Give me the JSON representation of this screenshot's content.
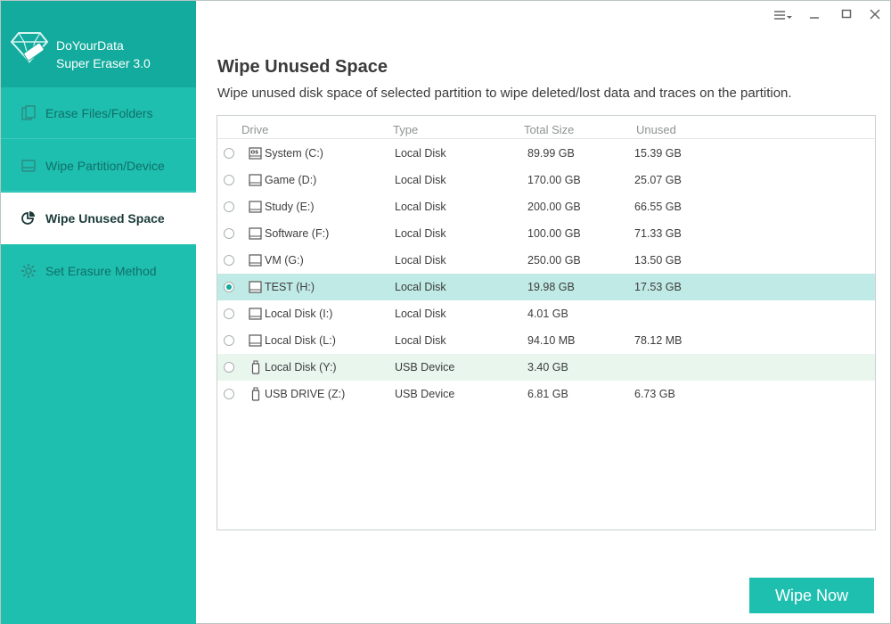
{
  "app": {
    "brand_line1": "DoYourData",
    "brand_line2": "Super Eraser 3.0"
  },
  "sidebar": {
    "items": [
      {
        "label": "Erase Files/Folders",
        "icon": "files-icon",
        "active": false
      },
      {
        "label": "Wipe Partition/Device",
        "icon": "drive-icon",
        "active": false
      },
      {
        "label": "Wipe Unused Space",
        "icon": "pie-chart-icon",
        "active": true
      },
      {
        "label": "Set Erasure Method",
        "icon": "gear-icon",
        "active": false
      }
    ]
  },
  "window_controls": {
    "menu": "menu-icon",
    "minimize": "minimize-icon",
    "maximize": "maximize-icon",
    "close": "close-icon"
  },
  "main": {
    "title": "Wipe Unused Space",
    "subtitle": "Wipe unused disk space of selected partition to wipe deleted/lost data and traces on the partition."
  },
  "table": {
    "headers": {
      "drive": "Drive",
      "type": "Type",
      "total": "Total Size",
      "unused": "Unused"
    },
    "rows": [
      {
        "drive": "System (C:)",
        "type": "Local Disk",
        "total": "89.99 GB",
        "unused": "15.39 GB",
        "icon": "os-drive-icon",
        "selected": false
      },
      {
        "drive": "Game (D:)",
        "type": "Local Disk",
        "total": "170.00 GB",
        "unused": "25.07 GB",
        "icon": "hard-drive-icon",
        "selected": false
      },
      {
        "drive": "Study (E:)",
        "type": "Local Disk",
        "total": "200.00 GB",
        "unused": "66.55 GB",
        "icon": "hard-drive-icon",
        "selected": false
      },
      {
        "drive": "Software (F:)",
        "type": "Local Disk",
        "total": "100.00 GB",
        "unused": "71.33 GB",
        "icon": "hard-drive-icon",
        "selected": false
      },
      {
        "drive": "VM (G:)",
        "type": "Local Disk",
        "total": "250.00 GB",
        "unused": "13.50 GB",
        "icon": "hard-drive-icon",
        "selected": false
      },
      {
        "drive": "TEST (H:)",
        "type": "Local Disk",
        "total": "19.98 GB",
        "unused": "17.53 GB",
        "icon": "hard-drive-icon",
        "selected": true
      },
      {
        "drive": "Local Disk (I:)",
        "type": "Local Disk",
        "total": "4.01 GB",
        "unused": "",
        "icon": "hard-drive-icon",
        "selected": false
      },
      {
        "drive": "Local Disk (L:)",
        "type": "Local Disk",
        "total": "94.10 MB",
        "unused": "78.12 MB",
        "icon": "hard-drive-icon",
        "selected": false
      },
      {
        "drive": "Local Disk (Y:)",
        "type": "USB Device",
        "total": "3.40 GB",
        "unused": "",
        "icon": "usb-drive-icon",
        "selected": false
      },
      {
        "drive": "USB DRIVE (Z:)",
        "type": "USB Device",
        "total": "6.81 GB",
        "unused": "6.73 GB",
        "icon": "usb-drive-icon",
        "selected": false
      }
    ]
  },
  "actions": {
    "wipe_now": "Wipe Now"
  },
  "colors": {
    "accent": "#1fbfb0",
    "brand_bg": "#12ab9d",
    "selected_row": "#c0eae5"
  }
}
